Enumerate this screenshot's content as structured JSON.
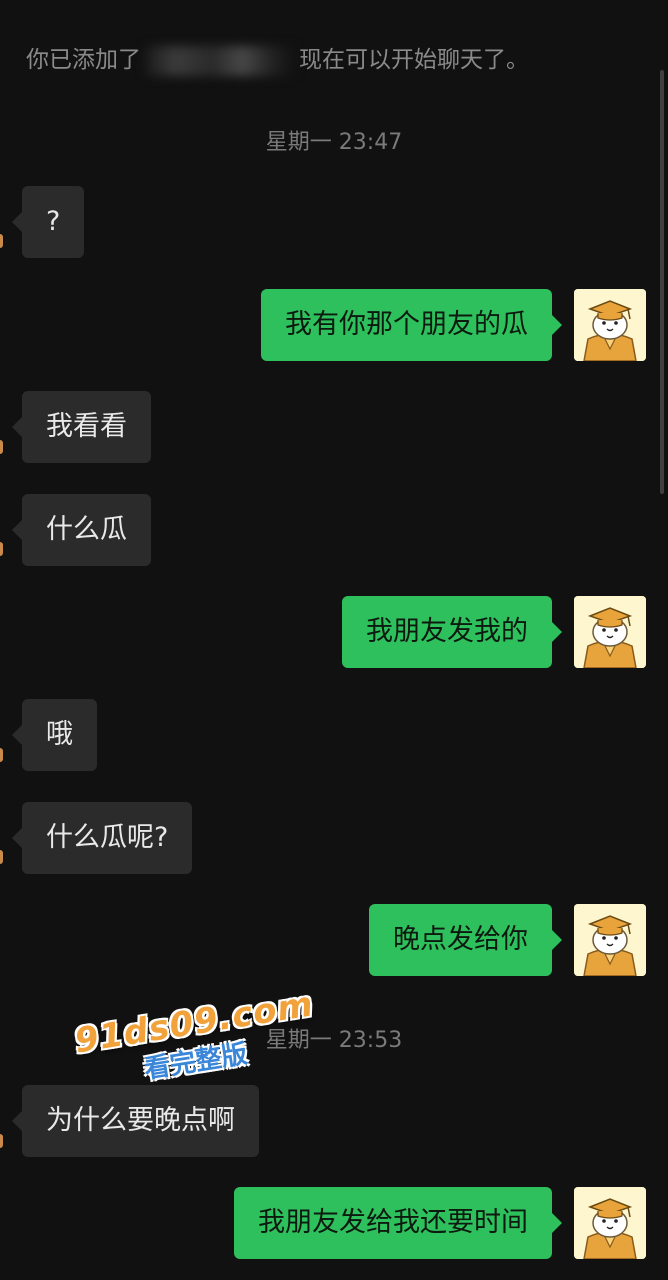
{
  "system_notice": {
    "prefix": "你已添加了",
    "suffix": "现在可以开始聊天了。"
  },
  "timestamps": [
    "星期一 23:47",
    "星期一 23:53"
  ],
  "messages": [
    {
      "side": "left",
      "text": "?"
    },
    {
      "side": "right",
      "text": "我有你那个朋友的瓜"
    },
    {
      "side": "left",
      "text": "我看看"
    },
    {
      "side": "left",
      "text": "什么瓜"
    },
    {
      "side": "right",
      "text": "我朋友发我的"
    },
    {
      "side": "left",
      "text": "哦"
    },
    {
      "side": "left",
      "text": "什么瓜呢?"
    },
    {
      "side": "right",
      "text": "晚点发给你"
    },
    {
      "side": "left",
      "text": "为什么要晚点啊"
    },
    {
      "side": "right",
      "text": "我朋友发给我还要时间"
    }
  ],
  "watermark": {
    "main": "91ds09.com",
    "sub": "看完整版"
  },
  "colors": {
    "background": "#111111",
    "incoming_bubble": "#2b2b2b",
    "outgoing_bubble": "#2ec05c",
    "timestamp_text": "#7a7a7a"
  },
  "icons": {
    "avatar": "cartoon-dog-graduate-avatar-icon"
  }
}
